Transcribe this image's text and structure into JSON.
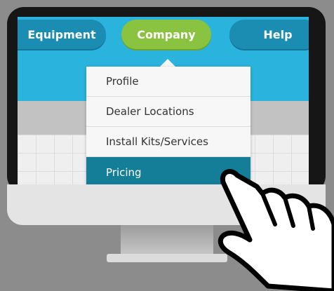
{
  "nav": {
    "items": [
      {
        "label": "Equipment"
      },
      {
        "label": "Company",
        "active": true
      },
      {
        "label": "Help"
      }
    ]
  },
  "dropdown": {
    "items": [
      {
        "label": "Profile"
      },
      {
        "label": "Dealer Locations"
      },
      {
        "label": "Install Kits/Services"
      },
      {
        "label": "Pricing",
        "highlighted": true
      }
    ]
  },
  "colors": {
    "nav_band": "#2ab3dc",
    "nav_button": "#1b8db3",
    "active_button": "#8ac33f",
    "highlight": "#147e98",
    "background": "#8c8c8c"
  },
  "icons": [
    "pointing-hand-icon"
  ]
}
